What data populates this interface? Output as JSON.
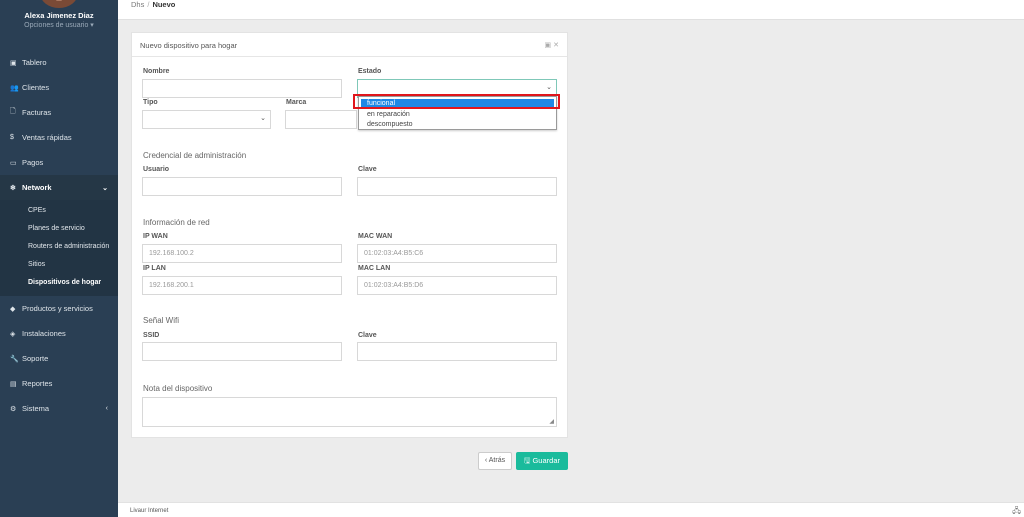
{
  "user": {
    "name": "Alexa Jimenez Diaz",
    "options": "Opciones de usuario ▾"
  },
  "nav": {
    "tablero": "Tablero",
    "clientes": "Clientes",
    "facturas": "Facturas",
    "ventas": "Ventas rápidas",
    "pagos": "Pagos",
    "network": "Network",
    "network_sub": [
      "CPEs",
      "Planes de servicio",
      "Routers de administración",
      "Sitios",
      "Dispositivos de hogar"
    ],
    "productos": "Productos y servicios",
    "instalaciones": "Instalaciones",
    "soporte": "Soporte",
    "reportes": "Reportes",
    "sistema": "Sistema"
  },
  "breadcrumb": {
    "parent": "Dhs",
    "current": "Nuevo"
  },
  "panel": {
    "title": "Nuevo dispositivo para hogar"
  },
  "form": {
    "nombre": "Nombre",
    "estado": "Estado",
    "tipo": "Tipo",
    "marca": "Marca",
    "estado_options": [
      "funcional",
      "en reparación",
      "descompuesto"
    ],
    "credencial_section": "Credencial de administración",
    "usuario": "Usuario",
    "clave": "Clave",
    "red_section": "Información de red",
    "ip_wan": "IP WAN",
    "ip_wan_placeholder": "192.168.100.2",
    "mac_wan": "MAC WAN",
    "mac_wan_placeholder": "01:02:03:A4:B5:C6",
    "ip_lan": "IP LAN",
    "ip_lan_placeholder": "192.168.200.1",
    "mac_lan": "MAC LAN",
    "mac_lan_placeholder": "01:02:03:A4:B5:D6",
    "wifi_section": "Señal Wifi",
    "ssid": "SSID",
    "wifi_clave": "Clave",
    "nota_section": "Nota del dispositivo"
  },
  "buttons": {
    "back": "‹ Atrás",
    "save": "🖫 Guardar"
  },
  "footer": {
    "text": "Livaur Internet"
  },
  "colors": {
    "sidebar": "#2a3f54",
    "save": "#1abb9c",
    "selected_option": "#1e88e5",
    "highlight": "#e0161c"
  }
}
